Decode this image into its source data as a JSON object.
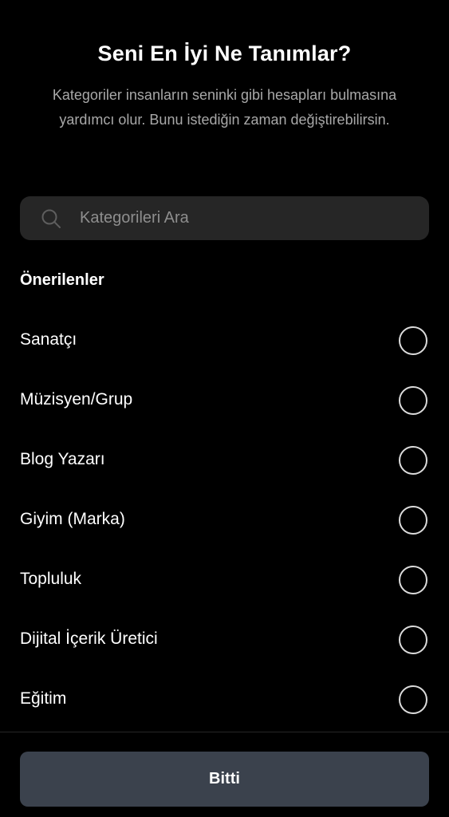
{
  "header": {
    "title": "Seni En İyi Ne Tanımlar?",
    "subtitle": "Kategoriler insanların seninki gibi hesapları bulmasına yardımcı olur. Bunu istediğin zaman değiştirebilirsin."
  },
  "search": {
    "placeholder": "Kategorileri Ara",
    "value": "",
    "icon": "search-icon"
  },
  "suggested": {
    "heading": "Önerilenler",
    "items": [
      {
        "label": "Sanatçı",
        "selected": false
      },
      {
        "label": "Müzisyen/Grup",
        "selected": false
      },
      {
        "label": "Blog Yazarı",
        "selected": false
      },
      {
        "label": "Giyim (Marka)",
        "selected": false
      },
      {
        "label": "Topluluk",
        "selected": false
      },
      {
        "label": "Dijital İçerik Üretici",
        "selected": false
      },
      {
        "label": "Eğitim",
        "selected": false
      }
    ]
  },
  "footer": {
    "done_label": "Bitti"
  },
  "colors": {
    "background": "#000000",
    "search_background": "#262626",
    "button_background": "#3b424d",
    "secondary_text": "#a8a8a8",
    "radio_border": "#dbdbdb"
  }
}
